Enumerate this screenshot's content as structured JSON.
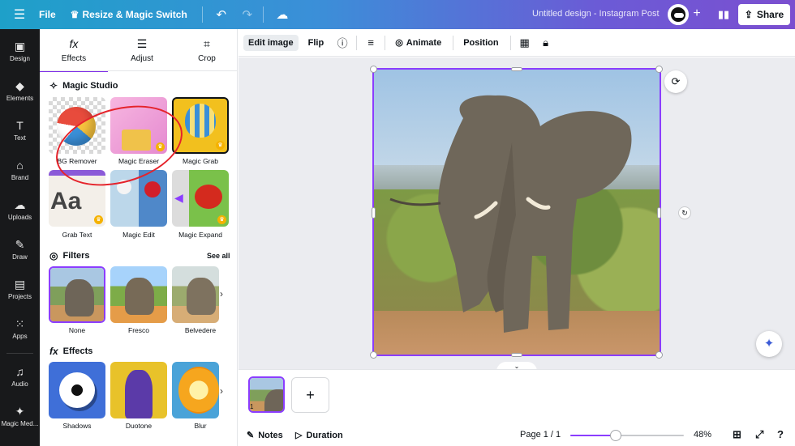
{
  "topbar": {
    "menu_icon": "hamburger-icon",
    "file_label": "File",
    "resize_label": "Resize & Magic Switch",
    "design_title": "Untitled design - Instagram Post",
    "share_label": "Share"
  },
  "rail": {
    "items": [
      {
        "label": "Design",
        "icon": "layout-icon"
      },
      {
        "label": "Elements",
        "icon": "shapes-icon"
      },
      {
        "label": "Text",
        "icon": "text-icon"
      },
      {
        "label": "Brand",
        "icon": "brand-icon"
      },
      {
        "label": "Uploads",
        "icon": "cloud-upload-icon"
      },
      {
        "label": "Draw",
        "icon": "pen-icon"
      },
      {
        "label": "Projects",
        "icon": "folder-icon"
      },
      {
        "label": "Apps",
        "icon": "grid-icon"
      },
      {
        "label": "Audio",
        "icon": "music-icon"
      },
      {
        "label": "Magic Med...",
        "icon": "magic-media-icon"
      }
    ]
  },
  "panel": {
    "tabs": [
      {
        "label": "Effects",
        "icon": "fx-icon"
      },
      {
        "label": "Adjust",
        "icon": "sliders-icon"
      },
      {
        "label": "Crop",
        "icon": "crop-icon"
      }
    ],
    "magic_studio": {
      "title": "Magic Studio",
      "tools": [
        {
          "label": "BG Remover"
        },
        {
          "label": "Magic Eraser"
        },
        {
          "label": "Magic Grab"
        },
        {
          "label": "Grab Text"
        },
        {
          "label": "Magic Edit"
        },
        {
          "label": "Magic Expand"
        }
      ]
    },
    "filters": {
      "title": "Filters",
      "see_all": "See all",
      "items": [
        {
          "label": "None"
        },
        {
          "label": "Fresco"
        },
        {
          "label": "Belvedere"
        }
      ]
    },
    "effects": {
      "title": "Effects",
      "items": [
        {
          "label": "Shadows"
        },
        {
          "label": "Duotone"
        },
        {
          "label": "Blur"
        }
      ]
    }
  },
  "toolbar": {
    "edit_image": "Edit image",
    "flip": "Flip",
    "animate": "Animate",
    "position": "Position"
  },
  "pages": {
    "thumb_number": "1"
  },
  "bottombar": {
    "notes": "Notes",
    "duration": "Duration",
    "page_indicator": "Page 1 / 1",
    "zoom": "48%",
    "zoom_fraction": 0.4
  },
  "colors": {
    "accent": "#8b3dff",
    "annotation": "#e5232b"
  }
}
